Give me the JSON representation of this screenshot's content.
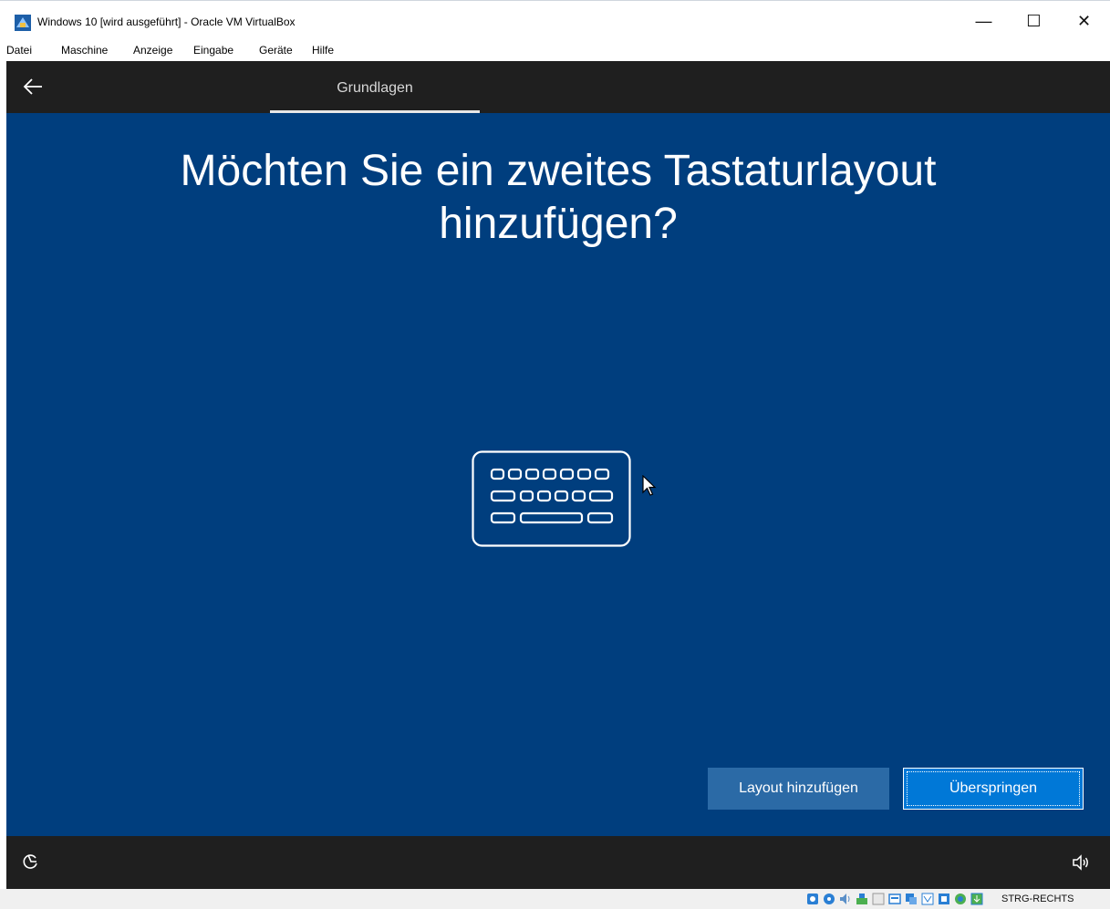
{
  "window": {
    "title": "Windows 10 [wird ausgeführt] - Oracle VM VirtualBox",
    "minimize_glyph": "—",
    "maximize_glyph": "☐",
    "close_glyph": "✕"
  },
  "menu": {
    "items": [
      "Datei",
      "Maschine",
      "Anzeige",
      "Eingabe",
      "Geräte",
      "Hilfe"
    ]
  },
  "oobe": {
    "tab_label": "Grundlagen",
    "heading_line1": "Möchten Sie ein zweites Tastaturlayout",
    "heading_line2": "hinzufügen?",
    "illustration_icon": "keyboard-icon",
    "buttons": {
      "add_layout": "Layout hinzufügen",
      "skip": "Überspringen"
    },
    "colors": {
      "background": "#003e7e",
      "bars": "#1f1f1f",
      "primary_button": "#0078d7",
      "secondary_button": "#2b6aa6"
    }
  },
  "statusbar": {
    "host_key": "STRG-RECHTS",
    "icons": [
      "hard-disk-icon",
      "optical-drive-icon",
      "audio-icon",
      "network-icon",
      "usb-icon",
      "shared-folder-icon",
      "display-icon",
      "recording-icon",
      "cpu-icon",
      "mouse-integration-icon",
      "keyboard-capture-icon"
    ]
  }
}
